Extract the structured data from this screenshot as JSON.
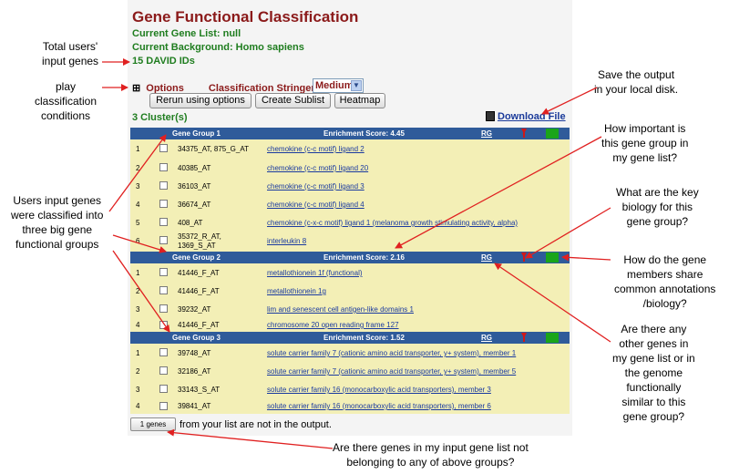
{
  "page": {
    "title": "Gene Functional Classification",
    "current_gene_list": "Current Gene List: null",
    "current_background": "Current Background: Homo sapiens",
    "id_count": "15 DAVID IDs",
    "options_label": "Options",
    "stringency_label": "Classification Stringency",
    "stringency_value": "Medium",
    "buttons": {
      "rerun": "Rerun using options",
      "create_sublist": "Create Sublist",
      "heatmap": "Heatmap"
    },
    "download_label": "Download File",
    "cluster_count": "3 Cluster(s)",
    "not_in_output_button": "1 genes",
    "not_in_output_text": "from your list are not in the output."
  },
  "groups": [
    {
      "name": "Gene Group 1",
      "score": "Enrichment Score: 4.45",
      "rg": "RG",
      "rows": [
        {
          "num": "1",
          "id": "34375_AT, 875_G_AT",
          "gene": "chemokine (c-c motif) ligand 2"
        },
        {
          "num": "2",
          "id": "40385_AT",
          "gene": "chemokine (c-c motif) ligand 20"
        },
        {
          "num": "3",
          "id": "36103_AT",
          "gene": "chemokine (c-c motif) ligand 3"
        },
        {
          "num": "4",
          "id": "36674_AT",
          "gene": "chemokine (c-c motif) ligand 4"
        },
        {
          "num": "5",
          "id": "408_AT",
          "gene": "chemokine (c-x-c motif) ligand 1 (melanoma growth stimulating activity, alpha)"
        },
        {
          "num": "6",
          "id": "35372_R_AT, 1369_S_AT",
          "id_line1": "35372_R_AT,",
          "id_line2": "1369_S_AT",
          "gene": "interleukin 8"
        }
      ]
    },
    {
      "name": "Gene Group 2",
      "score": "Enrichment Score: 2.16",
      "rg": "RG",
      "rows": [
        {
          "num": "1",
          "id": "41446_F_AT",
          "gene": "metallothionein 1f (functional)"
        },
        {
          "num": "2",
          "id": "41446_F_AT",
          "gene": "metallothionein 1g"
        },
        {
          "num": "3",
          "id": "39232_AT",
          "gene": "lim and senescent cell antigen-like domains 1"
        },
        {
          "num": "4",
          "id": "41446_F_AT",
          "gene": "chromosome 20 open reading frame 127"
        }
      ]
    },
    {
      "name": "Gene Group 3",
      "score": "Enrichment Score: 1.52",
      "rg": "RG",
      "rows": [
        {
          "num": "1",
          "id": "39748_AT",
          "gene": "solute carrier family 7 (cationic amino acid transporter, y+ system), member 1"
        },
        {
          "num": "2",
          "id": "32186_AT",
          "gene": "solute carrier family 7 (cationic amino acid transporter, y+ system), member 5"
        },
        {
          "num": "3",
          "id": "33143_S_AT",
          "gene": "solute carrier family 16 (monocarboxylic acid transporters), member 3"
        },
        {
          "num": "4",
          "id": "39841_AT",
          "gene": "solute carrier family 16 (monocarboxylic acid transporters), member 6"
        }
      ]
    }
  ],
  "annotations": {
    "total_users": [
      "Total users'",
      "input genes"
    ],
    "play_classification": [
      "play",
      "classification",
      "conditions"
    ],
    "users_input": [
      "Users input genes",
      "were classified into",
      "three big gene",
      "functional groups"
    ],
    "save_output": [
      "Save the output",
      "in your local disk."
    ],
    "how_important": [
      "How important is",
      "this gene group in",
      "my gene list?"
    ],
    "key_biology": [
      "What are the key",
      "biology for this",
      "gene group?"
    ],
    "share_annotations": [
      "How  do the gene",
      "members share",
      "common annotations",
      "/biology?"
    ],
    "other_genes": [
      "Are there any",
      "other genes in",
      "my  gene list or in",
      "the genome",
      "functionally",
      "similar to this",
      "gene group?"
    ],
    "not_belonging": [
      "Are there genes in my input gene list not",
      "belonging to any of above groups?"
    ]
  },
  "colors": {
    "title": "#8b1a1a",
    "green_text": "#1f7d1f",
    "group_header": "#2f5b9a",
    "row_bg": "#f3efb6",
    "link": "#1a3aa0",
    "arrow": "#e02020"
  }
}
